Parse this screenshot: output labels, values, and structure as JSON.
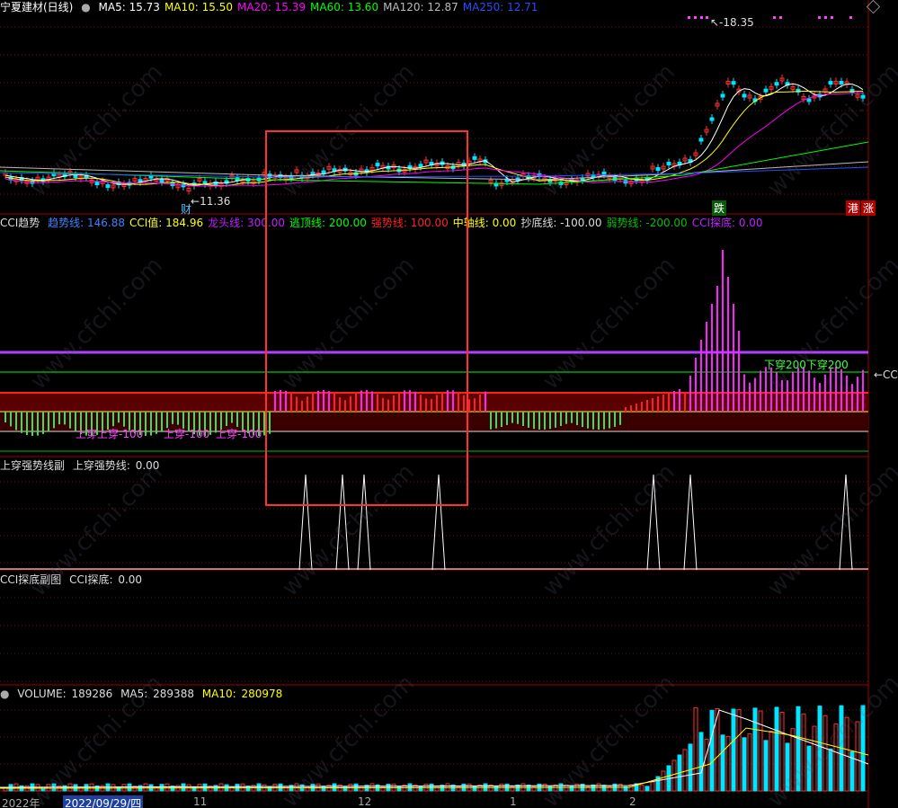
{
  "main_panel": {
    "stock_name": "宁夏建材(日线)",
    "ma": [
      {
        "label": "MA5",
        "value": "15.73",
        "color": "#ffffff"
      },
      {
        "label": "MA10",
        "value": "15.50",
        "color": "#ffff00"
      },
      {
        "label": "MA20",
        "value": "15.39",
        "color": "#ff00ff"
      },
      {
        "label": "MA60",
        "value": "13.60",
        "color": "#00ff00"
      },
      {
        "label": "MA120",
        "value": "12.87",
        "color": "#bbbbbb"
      },
      {
        "label": "MA250",
        "value": "12.71",
        "color": "#2050ff"
      }
    ],
    "high_marker": "18.35",
    "low_marker": "11.36",
    "tag_cai": "财",
    "tag_die": "跌",
    "tag_gang": "港",
    "tag_zhang": "涨"
  },
  "cci_panel": {
    "title": "CCI趋势",
    "items": [
      {
        "label": "趋势线:",
        "value": "146.88",
        "color": "#4080ff"
      },
      {
        "label": "CCI值:",
        "value": "184.96",
        "color": "#ffff00"
      },
      {
        "label": "龙头线:",
        "value": "300.00",
        "color": "#c020ff"
      },
      {
        "label": "逃顶线:",
        "value": "200.00",
        "color": "#00ff00"
      },
      {
        "label": "强势线:",
        "value": "100.00",
        "color": "#ff2020"
      },
      {
        "label": "中轴线:",
        "value": "0.00",
        "color": "#ffff00"
      },
      {
        "label": "抄底线:",
        "value": "-100.00",
        "color": "#dddddd"
      },
      {
        "label": "弱势线:",
        "value": "-200.00",
        "color": "#00c000"
      },
      {
        "label": "CCI探底:",
        "value": "0.00",
        "color": "#c020ff"
      }
    ],
    "annot_up1": "上穿上穿-100",
    "annot_up2": "上穿-100",
    "annot_up3": "上穿-100",
    "annot_down": "下穿200下穿200",
    "right_marker": "←CC"
  },
  "cross_panel": {
    "title": "上穿强势线副",
    "label": "上穿强势线:",
    "value": "0.00"
  },
  "bottom_panel": {
    "title": "CCI探底副图",
    "label": "CCI探底:",
    "value": "0.00"
  },
  "volume_panel": {
    "label": "VOLUME:",
    "value": "189286",
    "ma5_label": "MA5:",
    "ma5_value": "289388",
    "ma10_label": "MA10:",
    "ma10_value": "280978"
  },
  "axis": {
    "year": "2022年",
    "date": "2022/09/29/四",
    "m1": "11",
    "m2": "12",
    "m3": "1",
    "m4": "2"
  },
  "watermark": "www.cfchi.com"
}
